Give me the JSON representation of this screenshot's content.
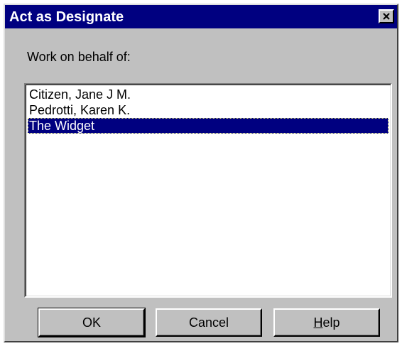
{
  "window": {
    "title": "Act as Designate",
    "close_icon": "close-icon"
  },
  "prompt": {
    "label": "Work on behalf of:"
  },
  "list": {
    "items": [
      {
        "label": "Citizen, Jane J M."
      },
      {
        "label": "Pedrotti, Karen K."
      },
      {
        "label": "The Widget"
      }
    ],
    "selected_index": 2
  },
  "buttons": {
    "ok_label": "OK",
    "cancel_label": "Cancel",
    "help_mnemonic": "H",
    "help_rest": "elp"
  },
  "colors": {
    "face": "#c0c0c0",
    "title_bar": "#000080",
    "selection": "#000080",
    "list_background": "#ffffff"
  }
}
